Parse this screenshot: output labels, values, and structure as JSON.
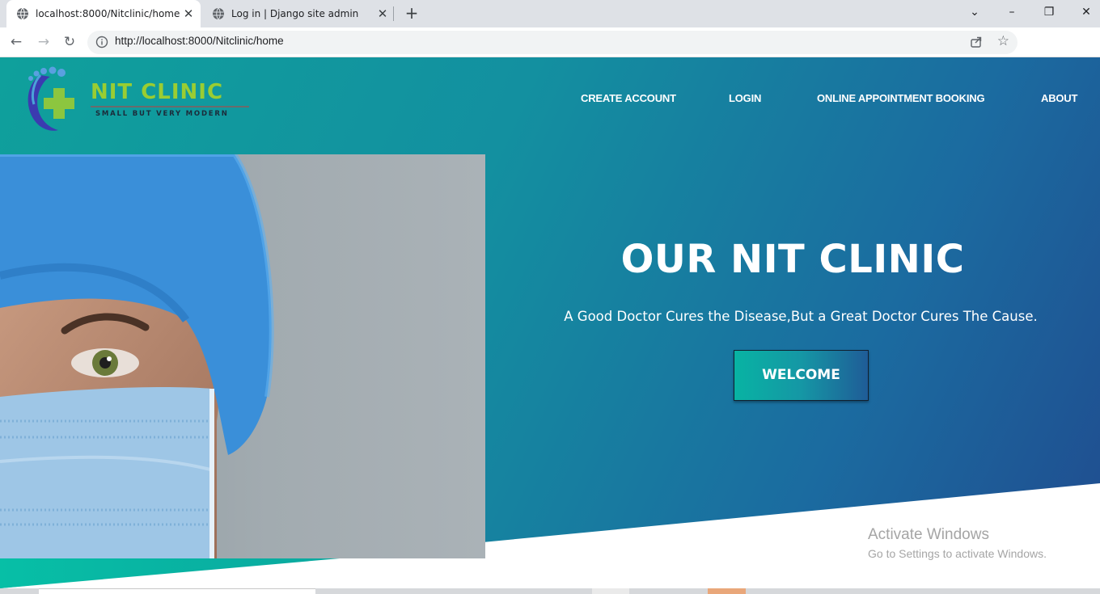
{
  "browser": {
    "tabs": [
      {
        "title": "localhost:8000/Nitclinic/home",
        "active": true
      },
      {
        "title": "Log in | Django site admin",
        "active": false
      }
    ],
    "url": "http://localhost:8000/Nitclinic/home"
  },
  "site": {
    "brand": "NIT CLINIC",
    "tagline": "SMALL BUT VERY MODERN",
    "nav": [
      "CREATE ACCOUNT",
      "LOGIN",
      "ONLINE APPOINTMENT BOOKING",
      "ABOUT"
    ]
  },
  "hero": {
    "title": "OUR NIT CLINIC",
    "subtitle": "A Good Doctor Cures the Disease,But a Great Doctor Cures The Cause.",
    "button": "WELCOME"
  },
  "watermark": {
    "line1": "Activate Windows",
    "line2": "Go to Settings to activate Windows."
  },
  "colors": {
    "hero_start": "#0fa09c",
    "hero_end": "#204c8f",
    "brand_green": "#9acd32"
  }
}
